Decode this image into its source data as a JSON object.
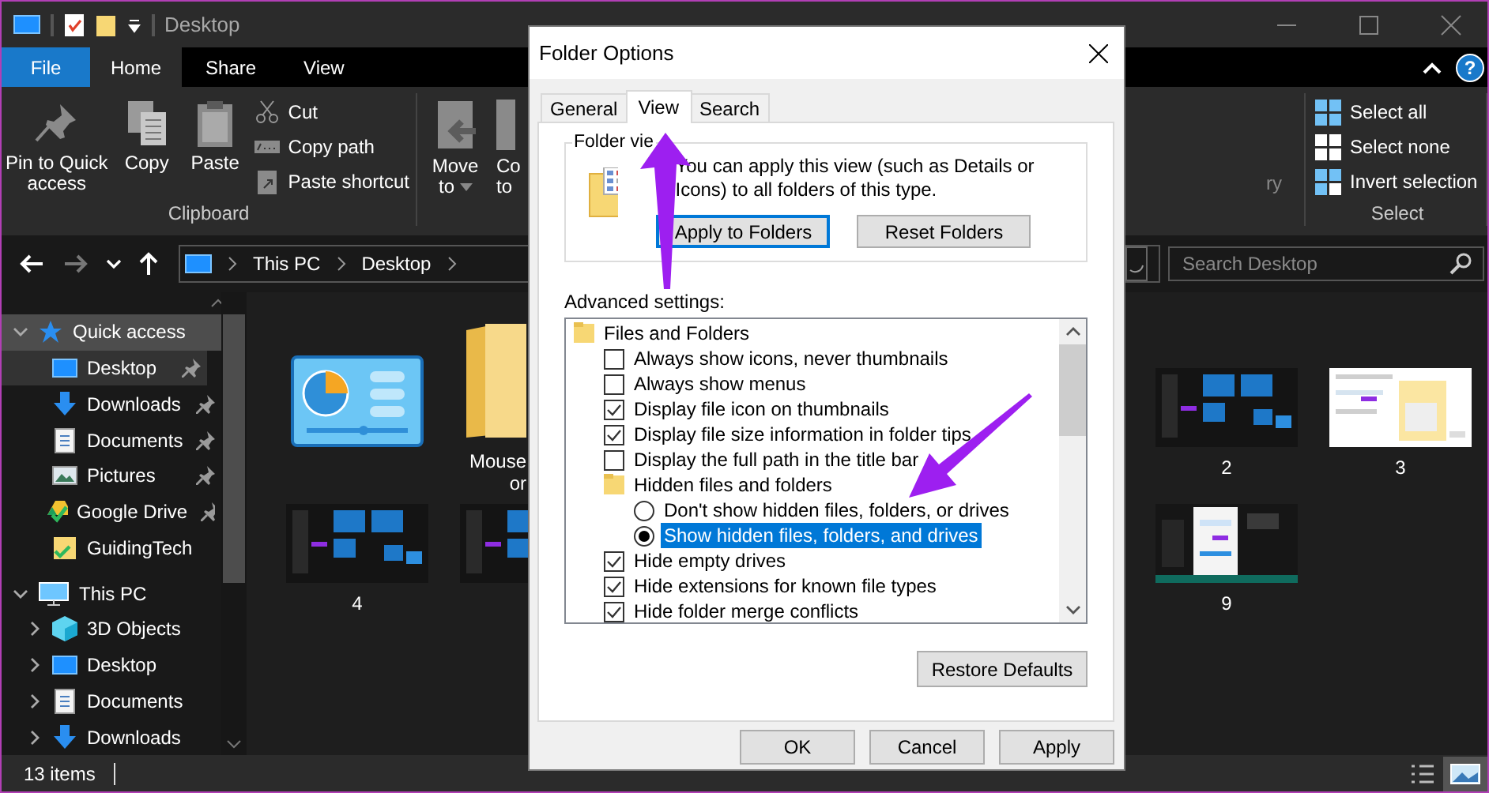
{
  "window": {
    "title": "Desktop"
  },
  "file_tab": "File",
  "ribbon_tabs": [
    {
      "label": "Home",
      "selected": true
    },
    {
      "label": "Share",
      "selected": false
    },
    {
      "label": "View",
      "selected": false
    }
  ],
  "help": "?",
  "clipboard": {
    "large_buttons": [
      {
        "label": "Pin to Quick access",
        "kind": "pin"
      },
      {
        "label": "Copy",
        "kind": "copy"
      },
      {
        "label": "Paste",
        "kind": "paste"
      }
    ],
    "small_buttons": [
      {
        "label": "Cut",
        "kind": "cut"
      },
      {
        "label": "Copy path",
        "kind": "copy-path"
      },
      {
        "label": "Paste shortcut",
        "kind": "paste-shortcut"
      }
    ],
    "group_label": "Clipboard"
  },
  "organize": {
    "buttons": [
      {
        "label": "Move to",
        "kind": "move",
        "dropdown": true
      },
      {
        "label": "Co to",
        "kind": "copy-to",
        "dropdown": false
      }
    ],
    "cut_label": "ry"
  },
  "select": {
    "items": [
      {
        "label": "Select all",
        "kind": "all"
      },
      {
        "label": "Select none",
        "kind": "none"
      },
      {
        "label": "Invert selection",
        "kind": "invert"
      }
    ],
    "group_label": "Select"
  },
  "nav": [
    {
      "kind": "back",
      "disabled": false
    },
    {
      "kind": "forward",
      "disabled": true
    },
    {
      "kind": "recent",
      "disabled": false
    },
    {
      "kind": "up",
      "disabled": false
    }
  ],
  "address": {
    "crumbs": [
      "This PC",
      "Desktop"
    ],
    "search_placeholder": "Search Desktop"
  },
  "sidebar": [
    {
      "label": "Quick access",
      "kind": "quick",
      "expanded": true,
      "hovered": true,
      "selected": false,
      "children": [
        {
          "label": "Desktop",
          "kind": "desktop",
          "pinned": true,
          "selected": true
        },
        {
          "label": "Downloads",
          "kind": "downloads",
          "pinned": true,
          "selected": false
        },
        {
          "label": "Documents",
          "kind": "documents",
          "pinned": true,
          "selected": false
        },
        {
          "label": "Pictures",
          "kind": "pictures",
          "pinned": true,
          "selected": false
        },
        {
          "label": "Google Drive",
          "kind": "drive",
          "pinned": true,
          "selected": false
        },
        {
          "label": "GuidingTech",
          "kind": "folder-check",
          "pinned": false,
          "selected": false
        }
      ]
    },
    {
      "label": "This PC",
      "kind": "pc",
      "expanded": true,
      "hovered": false,
      "selected": false,
      "children": [
        {
          "label": "3D Objects",
          "kind": "objects",
          "expanded": false,
          "selected": false
        },
        {
          "label": "Desktop",
          "kind": "desktop",
          "expanded": false,
          "selected": false
        },
        {
          "label": "Documents",
          "kind": "documents",
          "expanded": false,
          "selected": false
        },
        {
          "label": "Downloads",
          "kind": "downloads",
          "expanded": false,
          "selected": false
        }
      ]
    }
  ],
  "files": [
    {
      "kind": "panel"
    },
    {
      "kind": "folder",
      "label_lines": [
        "Mouse",
        "or"
      ]
    },
    {
      "kind": "picture",
      "label_lines": [
        "2"
      ]
    },
    {
      "kind": "picture",
      "label_lines": [
        "3"
      ]
    },
    {
      "kind": "picture",
      "label_lines": [
        "4"
      ]
    },
    {
      "kind": "picture"
    },
    {
      "kind": "picture",
      "label_lines": [
        "9"
      ]
    }
  ],
  "status_bar": {
    "count": "13 items",
    "views": [
      {
        "kind": "details",
        "selected": false
      },
      {
        "kind": "large-icons",
        "selected": true
      }
    ]
  },
  "dialog": {
    "title": "Folder Options",
    "tabs": [
      {
        "label": "General",
        "selected": false
      },
      {
        "label": "View",
        "selected": true
      },
      {
        "label": "Search",
        "selected": false
      }
    ],
    "folder_views": {
      "legend": "Folder vie",
      "text": "You can apply this view (such as Details or Icons) to all folders of this type.",
      "buttons": [
        {
          "label": "Apply to Folders",
          "focused": true
        },
        {
          "label": "Reset Folders",
          "focused": false
        }
      ]
    },
    "advanced_label": "Advanced settings:",
    "settings": [
      {
        "label": "Files and Folders",
        "kind": "folder",
        "children": [
          {
            "label": "Always show icons, never thumbnails",
            "kind": "checkbox",
            "checked": false
          },
          {
            "label": "Always show menus",
            "kind": "checkbox",
            "checked": false
          },
          {
            "label": "Display file icon on thumbnails",
            "kind": "checkbox",
            "checked": true
          },
          {
            "label": "Display file size information in folder tips",
            "kind": "checkbox",
            "checked": true
          },
          {
            "label": "Display the full path in the title bar",
            "kind": "checkbox",
            "checked": false
          },
          {
            "label": "Hidden files and folders",
            "kind": "folder",
            "children": [
              {
                "label": "Don't show hidden files, folders, or drives",
                "kind": "radio",
                "selected": false
              },
              {
                "label": "Show hidden files, folders, and drives",
                "kind": "radio",
                "selected": true
              }
            ]
          },
          {
            "label": "Hide empty drives",
            "kind": "checkbox",
            "checked": true
          },
          {
            "label": "Hide extensions for known file types",
            "kind": "checkbox",
            "checked": true
          },
          {
            "label": "Hide folder merge conflicts",
            "kind": "checkbox",
            "checked": true
          }
        ]
      }
    ],
    "restore": "Restore Defaults",
    "buttons": [
      "OK",
      "Cancel",
      "Apply"
    ]
  }
}
